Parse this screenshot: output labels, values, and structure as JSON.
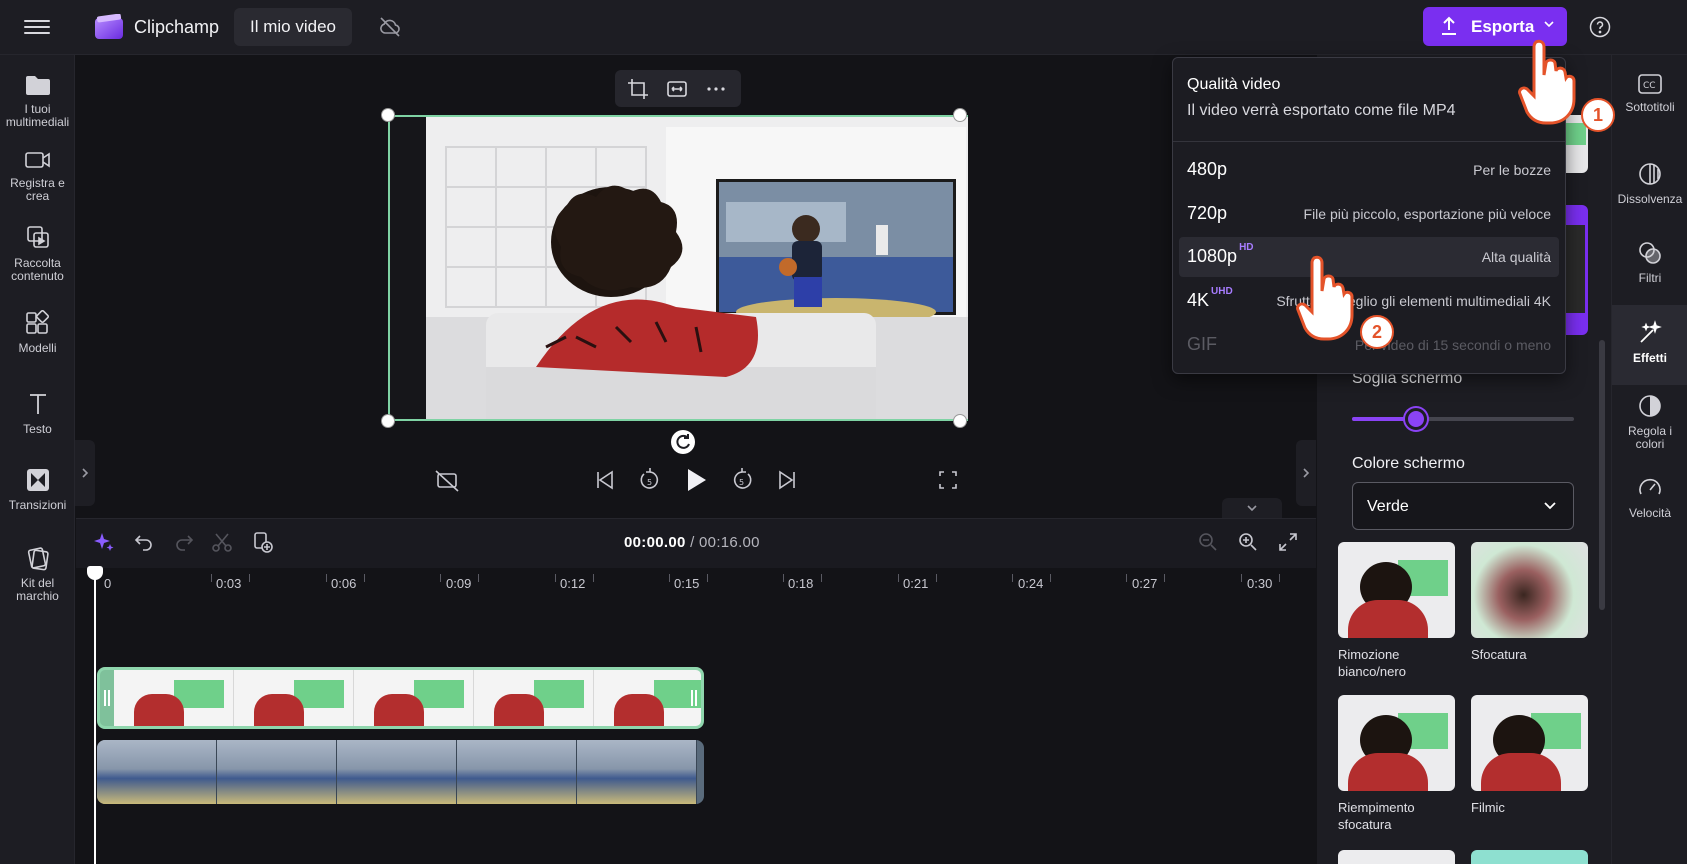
{
  "app": {
    "brand": "Clipchamp",
    "project_name": "Il mio video"
  },
  "topbar": {
    "export_label": "Esporta"
  },
  "left_nav": [
    {
      "label": "I tuoi multimediali",
      "icon": "folder-icon"
    },
    {
      "label": "Registra e crea",
      "icon": "camera-icon"
    },
    {
      "label": "Raccolta contenuto",
      "icon": "content-library-icon"
    },
    {
      "label": "Modelli",
      "icon": "templates-icon"
    },
    {
      "label": "Testo",
      "icon": "text-icon"
    },
    {
      "label": "Transizioni",
      "icon": "transitions-icon"
    },
    {
      "label": "Kit del marchio",
      "icon": "brand-kit-icon"
    }
  ],
  "right_nav": [
    {
      "label": "Sottotitoli",
      "icon": "captions-icon"
    },
    {
      "label": "Dissolvenza",
      "icon": "fade-icon"
    },
    {
      "label": "Filtri",
      "icon": "filters-icon"
    },
    {
      "label": "Effetti",
      "icon": "effects-wand-icon",
      "active": true
    },
    {
      "label": "Regola i colori",
      "icon": "adjust-colors-icon"
    },
    {
      "label": "Velocità",
      "icon": "speed-icon"
    }
  ],
  "export_menu": {
    "title": "Qualità video",
    "subtitle": "Il video verrà esportato come file MP4",
    "options": [
      {
        "res": "480p",
        "badge": "",
        "desc": "Per le bozze"
      },
      {
        "res": "720p",
        "badge": "",
        "desc": "File più piccolo, esportazione più veloce"
      },
      {
        "res": "1080p",
        "badge": "HD",
        "desc": "Alta qualità",
        "selected": true
      },
      {
        "res": "4K",
        "badge": "UHD",
        "desc": "Sfrutta al meglio gli elementi multimediali 4K"
      },
      {
        "res": "GIF",
        "badge": "",
        "desc": "Per video di 15 secondi o meno",
        "disabled": true
      }
    ]
  },
  "effects_panel": {
    "threshold_label": "Soglia schermo",
    "threshold_value": 0.29,
    "color_label": "Colore schermo",
    "color_value": "Verde",
    "effects": [
      {
        "name": "Rimozione bianco/nero"
      },
      {
        "name": "Sfocatura"
      },
      {
        "name": "Riempimento sfocatura"
      },
      {
        "name": "Filmic"
      }
    ]
  },
  "timeline": {
    "current_time": "00:00.00",
    "total_time": "/ 00:16.00",
    "ticks": [
      "0",
      "0:03",
      "0:06",
      "0:09",
      "0:12",
      "0:15",
      "0:18",
      "0:21",
      "0:24",
      "0:27",
      "0:30"
    ]
  },
  "annotations": {
    "step1": "1",
    "step2": "2"
  },
  "colors": {
    "accent": "#7a2ff0",
    "selection": "#7fd3a4",
    "annotation": "#e4532a"
  }
}
